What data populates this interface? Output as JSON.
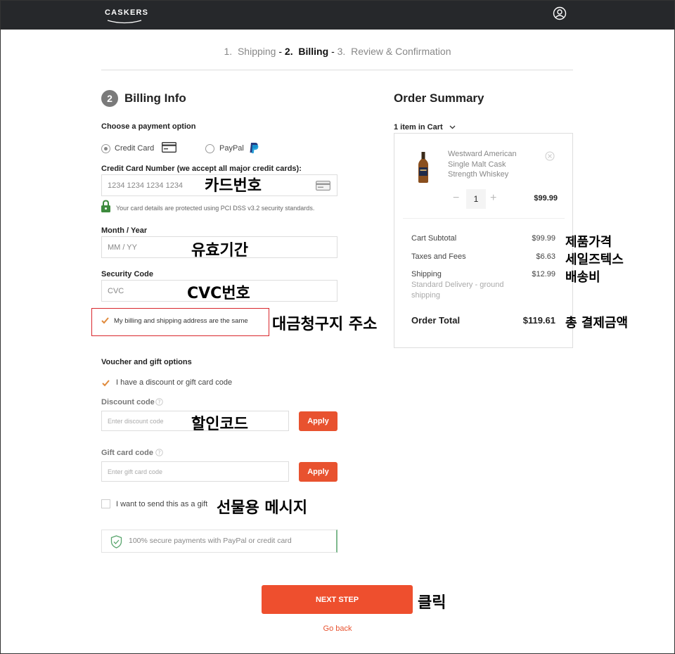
{
  "header": {
    "logo_text": "CASKERS",
    "user_icon": "user-circle-icon"
  },
  "steps": [
    {
      "number": "1.",
      "label": "Shipping",
      "active": false
    },
    {
      "number": "2.",
      "label": "Billing",
      "active": true
    },
    {
      "number": "3.",
      "label": "Review & Confirmation",
      "active": false
    }
  ],
  "billing": {
    "section_number": "2",
    "title": "Billing Info",
    "payment_option_label": "Choose a payment option",
    "options": {
      "credit_card": "Credit Card",
      "paypal": "PayPal"
    },
    "card_number_label": "Credit Card Number (we accept all major credit cards):",
    "card_number_placeholder": "1234 1234 1234 1234",
    "security_note": "Your card details are protected using PCI DSS v3.2 security standards.",
    "month_year_label": "Month / Year",
    "month_year_placeholder": "MM / YY",
    "security_code_label": "Security Code",
    "security_code_placeholder": "CVC",
    "same_address_label": "My billing and shipping address are the same"
  },
  "voucher": {
    "title": "Voucher and gift options",
    "discount_checkbox_label": "I have a discount or gift card code",
    "discount_code_label": "Discount code",
    "discount_placeholder": "Enter discount code",
    "gift_card_label": "Gift card code",
    "gift_card_placeholder": "Enter gift card code",
    "apply_label": "Apply",
    "gift_message_label": "I want to send this as a gift",
    "secure_note": "100% secure payments with PayPal or credit card"
  },
  "actions": {
    "next_step": "NEXT STEP",
    "go_back": "Go back"
  },
  "summary": {
    "title": "Order Summary",
    "cart_count": "1 item in Cart",
    "product_name": "Westward American Single Malt Cask Strength Whiskey",
    "quantity": "1",
    "item_price": "$99.99",
    "subtotal_label": "Cart Subtotal",
    "subtotal_value": "$99.99",
    "taxes_label": "Taxes and Fees",
    "taxes_value": "$6.63",
    "shipping_label": "Shipping",
    "shipping_value": "$12.99",
    "shipping_method": "Standard Delivery - ground shipping",
    "total_label": "Order Total",
    "total_value": "$119.61"
  },
  "annotations": {
    "card_number": "카드번호",
    "expiry": "유효기간",
    "cvc": "CVC번호",
    "billing_address": "대금청구지 주소",
    "discount_code": "할인코드",
    "gift_message": "선물용 메시지",
    "click": "클릭",
    "product_price": "제품가격",
    "sales_tax": "세일즈텍스",
    "shipping_fee": "배송비",
    "total_payment": "총 결제금액"
  },
  "colors": {
    "accent": "#e8522f",
    "header_bg": "#26282b",
    "highlight": "#d9262c",
    "check": "#e08a3c"
  }
}
